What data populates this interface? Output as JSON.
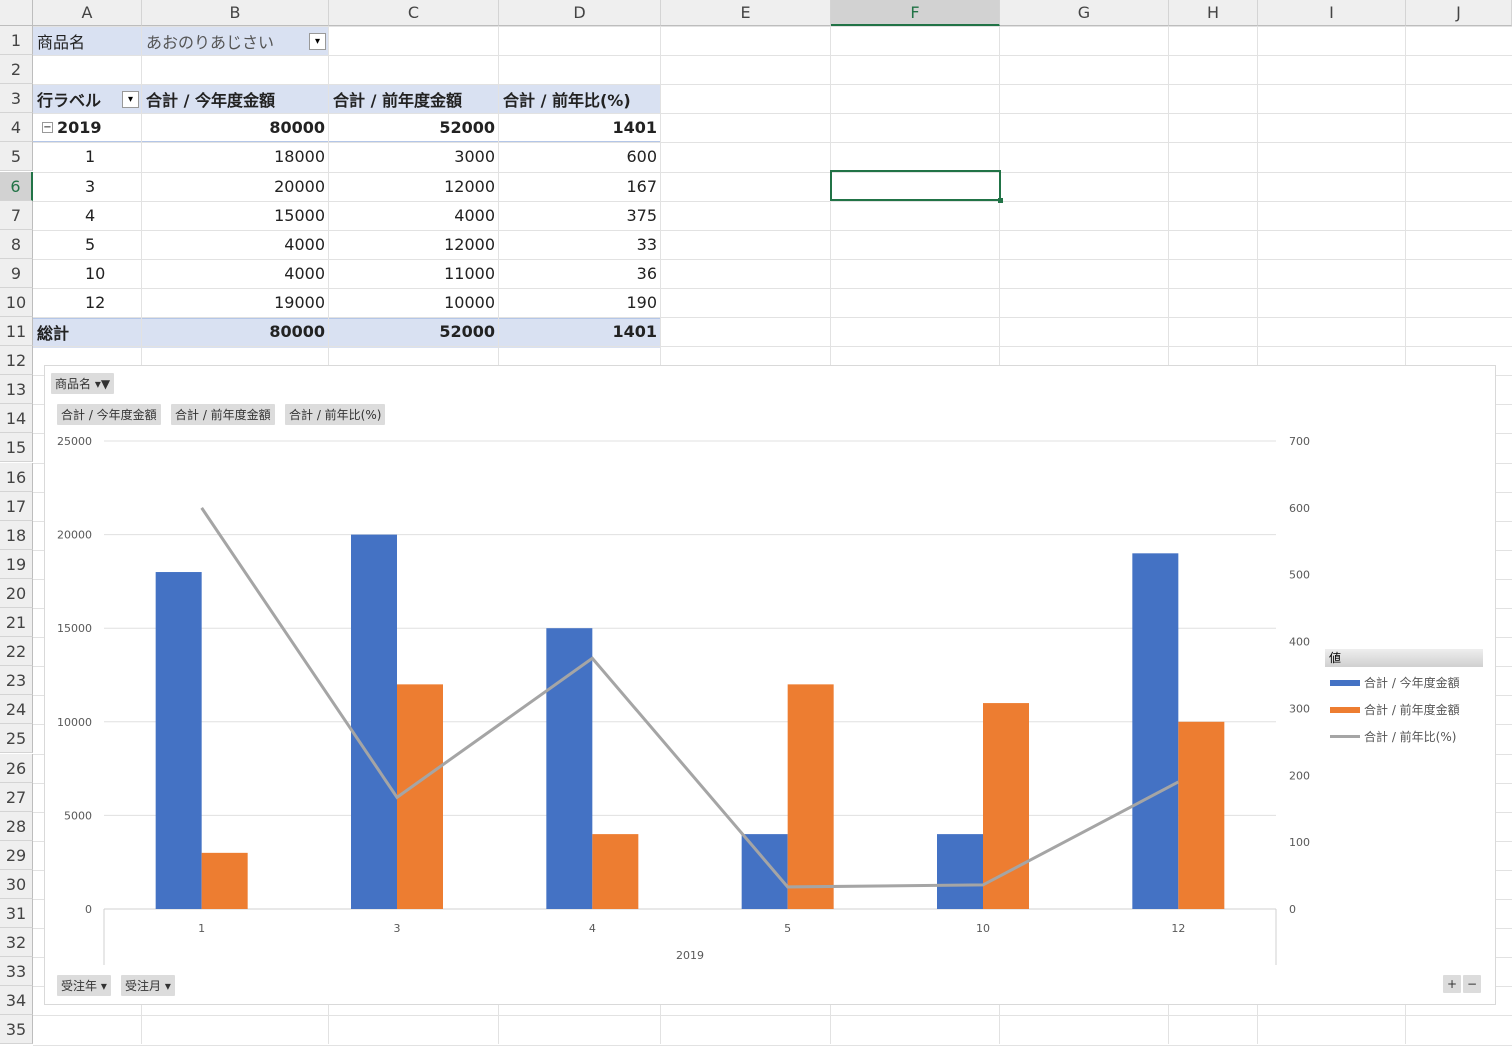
{
  "columns": [
    "A",
    "B",
    "C",
    "D",
    "E",
    "F",
    "G",
    "H",
    "I",
    "J"
  ],
  "selected_cell": "F6",
  "pivot": {
    "filter_label": "商品名",
    "filter_value": "あおのりあじさい",
    "headers": [
      "行ラベル",
      "合計 / 今年度金額",
      "合計 / 前年度金額",
      "合計 / 前年比(%)"
    ],
    "group": {
      "label": "2019",
      "values": [
        "80000",
        "52000",
        "1401"
      ]
    },
    "rows": [
      [
        "1",
        "18000",
        "3000",
        "600"
      ],
      [
        "3",
        "20000",
        "12000",
        "167"
      ],
      [
        "4",
        "15000",
        "4000",
        "375"
      ],
      [
        "5",
        "4000",
        "12000",
        "33"
      ],
      [
        "10",
        "4000",
        "11000",
        "36"
      ],
      [
        "12",
        "19000",
        "10000",
        "190"
      ]
    ],
    "total": {
      "label": "総計",
      "values": [
        "80000",
        "52000",
        "1401"
      ]
    }
  },
  "chart_buttons": {
    "filter": "商品名",
    "values": [
      "合計 / 今年度金額",
      "合計 / 前年度金額",
      "合計 / 前年比(%)"
    ],
    "axis": [
      "受注年",
      "受注月"
    ]
  },
  "colors": {
    "blue": "#4472c4",
    "orange": "#ed7d31",
    "gray": "#a5a5a5"
  },
  "chart_data": {
    "type": "bar",
    "categories": [
      "1",
      "3",
      "4",
      "5",
      "10",
      "12"
    ],
    "group_label": "2019",
    "series": [
      {
        "name": "合計 / 今年度金額",
        "type": "bar",
        "axis": "left",
        "values": [
          18000,
          20000,
          15000,
          4000,
          4000,
          19000
        ]
      },
      {
        "name": "合計 / 前年度金額",
        "type": "bar",
        "axis": "left",
        "values": [
          3000,
          12000,
          4000,
          12000,
          11000,
          10000
        ]
      },
      {
        "name": "合計 / 前年比(%)",
        "type": "line",
        "axis": "right",
        "values": [
          600,
          167,
          375,
          33,
          36,
          190
        ]
      }
    ],
    "ylim": [
      0,
      25000
    ],
    "yticks": [
      "0",
      "5000",
      "10000",
      "15000",
      "20000",
      "25000"
    ],
    "y2lim": [
      0,
      700
    ],
    "y2ticks": [
      "0",
      "100",
      "200",
      "300",
      "400",
      "500",
      "600",
      "700"
    ],
    "legend_title": "値",
    "legend_position": "right"
  }
}
